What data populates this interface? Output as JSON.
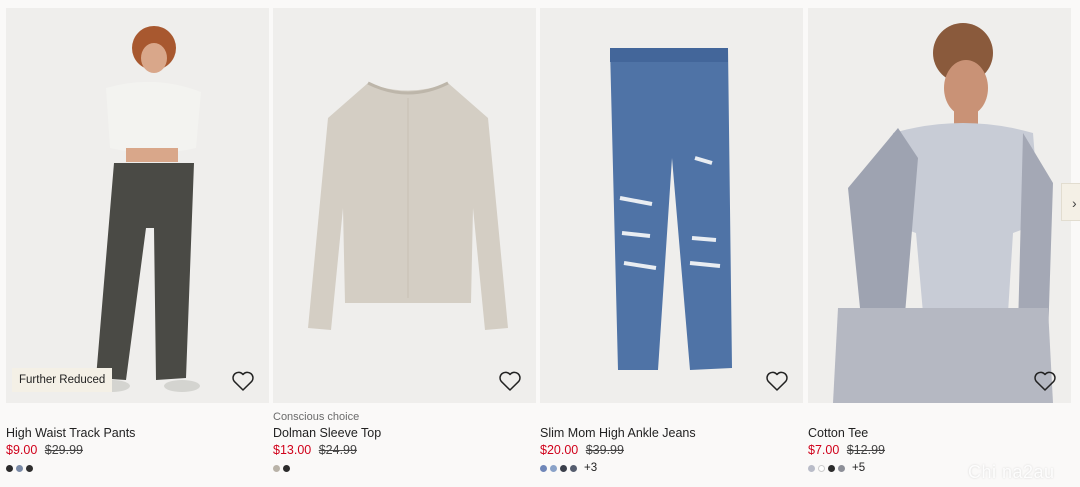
{
  "products": [
    {
      "badge": "Further Reduced",
      "tag": "",
      "name": "High Waist Track Pants",
      "price_new": "$9.00",
      "price_old": "$29.99",
      "swatches": [
        "#2b2b2b",
        "#7a8aa6",
        "#2f2f2f"
      ],
      "more": ""
    },
    {
      "badge": "",
      "tag": "Conscious choice",
      "name": "Dolman Sleeve Top",
      "price_new": "$13.00",
      "price_old": "$24.99",
      "swatches": [
        "#b9b3a8",
        "#2b2b2b"
      ],
      "more": ""
    },
    {
      "badge": "",
      "tag": "",
      "name": "Slim Mom High Ankle Jeans",
      "price_new": "$20.00",
      "price_old": "$39.99",
      "swatches": [
        "#6f86b8",
        "#8aa2c8",
        "#3a3f4a",
        "#555d6e"
      ],
      "more": "+3"
    },
    {
      "badge": "",
      "tag": "",
      "name": "Cotton Tee",
      "price_new": "$7.00",
      "price_old": "$12.99",
      "swatches": [
        "#b9bcc8",
        "#ffffff",
        "#2b2b2b",
        "#8d8f98"
      ],
      "more": "+5"
    }
  ],
  "icons": {
    "favorite": "heart-outline-icon",
    "scroll": "chevron-right-icon"
  },
  "watermark": "Chi na2au",
  "colors": {
    "sale_price": "#d0021b",
    "badge_bg": "#f4f0e6",
    "page_bg": "#faf9f8"
  }
}
